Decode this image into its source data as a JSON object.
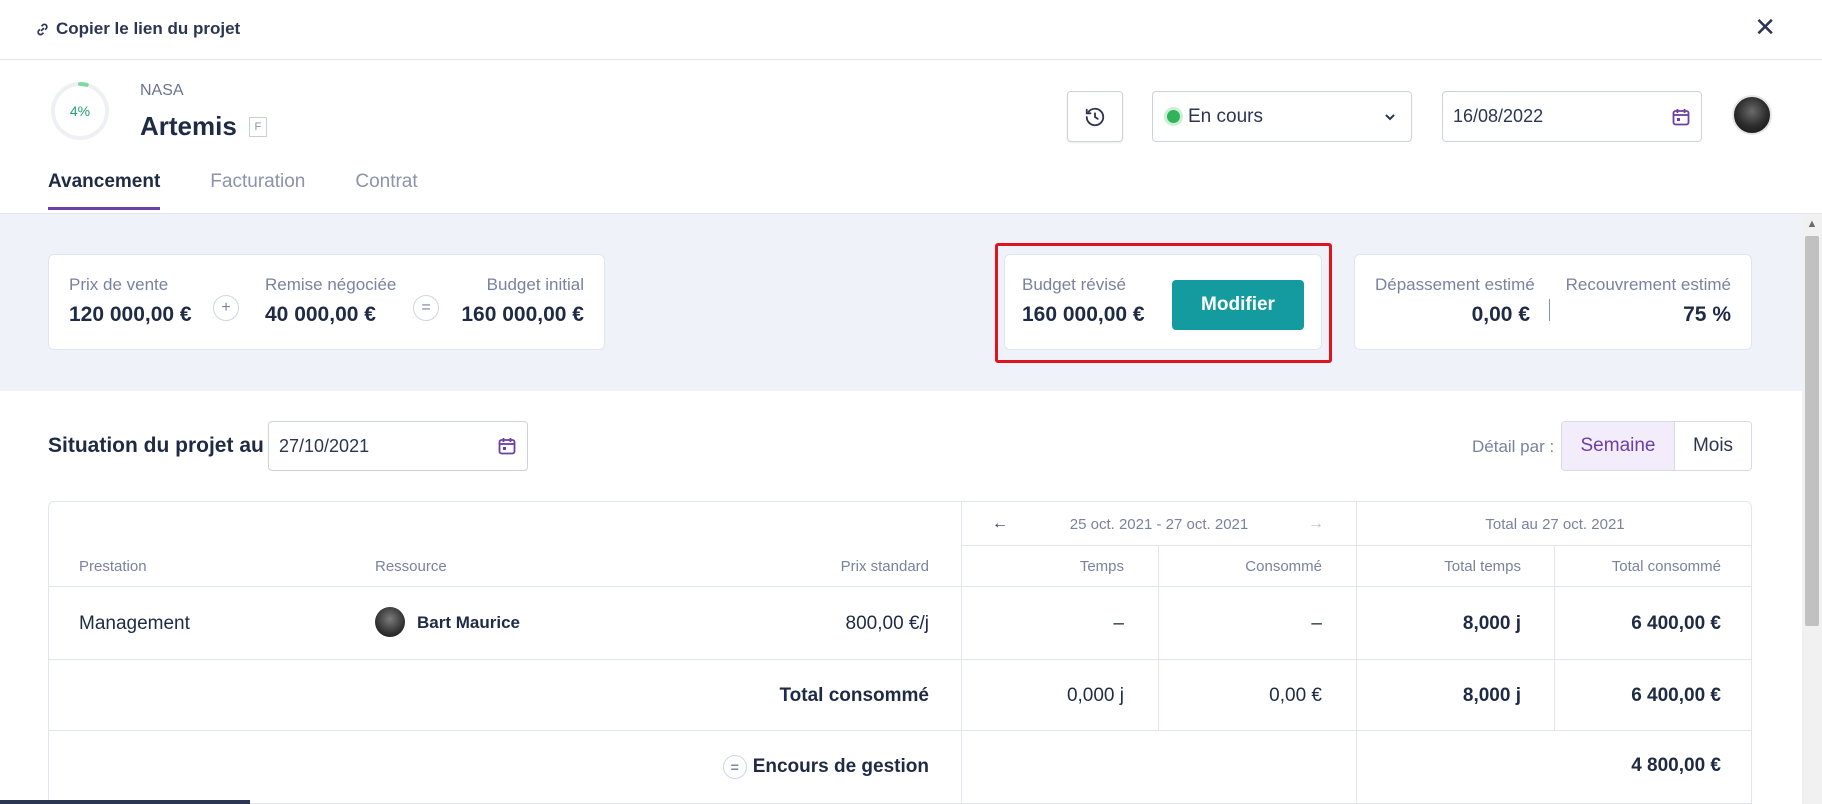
{
  "topbar": {
    "copy_link_label": "Copier le lien du projet",
    "close_label": "✕"
  },
  "project": {
    "progress_label": "4%",
    "progress_value": 0.04,
    "client": "NASA",
    "title": "Artemis",
    "badge": "F",
    "status": "En cours",
    "status_color": "#2fb45a",
    "date": "16/08/2022"
  },
  "tabs": [
    "Avancement",
    "Facturation",
    "Contrat"
  ],
  "summary": {
    "prix_vente_label": "Prix de vente",
    "prix_vente_value": "120 000,00 €",
    "plus": "+",
    "remise_label": "Remise négociée",
    "remise_value": "40 000,00 €",
    "equals": "=",
    "budget_initial_label": "Budget initial",
    "budget_initial_value": "160 000,00 €",
    "budget_revise_label": "Budget révisé",
    "budget_revise_value": "160 000,00 €",
    "modify_label": "Modifier",
    "depassement_label": "Dépassement estimé",
    "depassement_value": "0,00 €",
    "recouvrement_label": "Recouvrement estimé",
    "recouvrement_value": "75 %"
  },
  "situation": {
    "title": "Situation du projet au",
    "date": "27/10/2021",
    "detail_label": "Détail par :",
    "seg_week": "Semaine",
    "seg_month": "Mois"
  },
  "table": {
    "period_range": "25 oct. 2021 - 27 oct. 2021",
    "prev_arrow": "←",
    "next_arrow": "→",
    "total_header": "Total au 27 oct. 2021",
    "headers": {
      "prestation": "Prestation",
      "ressource": "Ressource",
      "prix_standard": "Prix standard",
      "temps": "Temps",
      "consomme": "Consommé",
      "total_temps": "Total temps",
      "total_consomme": "Total consommé"
    },
    "row": {
      "prestation": "Management",
      "ressource": "Bart Maurice",
      "prix_standard": "800,00 €/j",
      "temps": "–",
      "consomme": "–",
      "total_temps": "8,000 j",
      "total_consomme": "6 400,00 €"
    },
    "total_row": {
      "label": "Total consommé",
      "temps": "0,000 j",
      "consomme": "0,00 €",
      "total_temps": "8,000 j",
      "total_consomme": "6 400,00 €"
    },
    "encours_row": {
      "eq": "=",
      "label": "Encours de gestion",
      "total_consomme": "4 800,00 €"
    }
  }
}
